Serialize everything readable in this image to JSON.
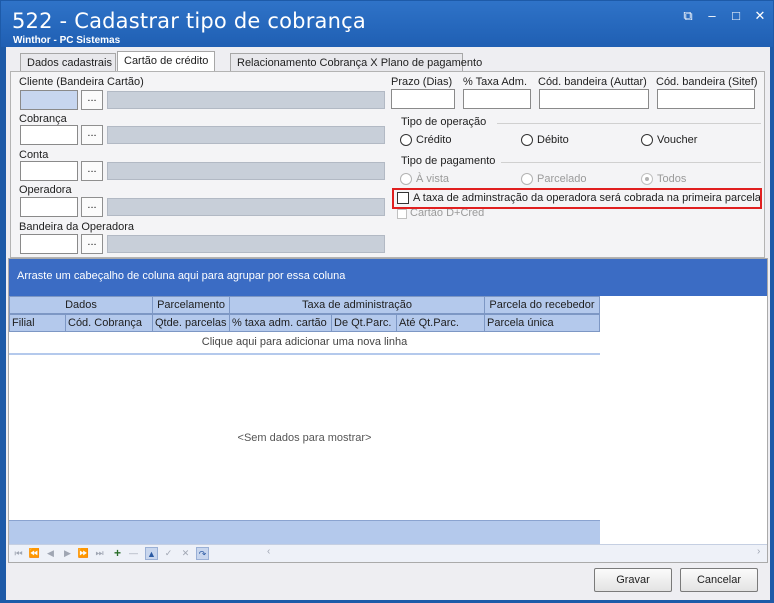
{
  "window": {
    "title": "522 - Cadastrar tipo de cobrança",
    "subtitle": "Winthor - PC Sistemas",
    "controls": [
      "⧉",
      "–",
      "□",
      "✕"
    ]
  },
  "tabs": [
    {
      "label": "Dados cadastrais"
    },
    {
      "label": "Cartão de crédito",
      "active": true
    },
    {
      "label": "Relacionamento Cobrança X Plano de pagamento"
    }
  ],
  "form": {
    "cliente_label": "Cliente (Bandeira Cartão)",
    "cobranca_label": "Cobrança",
    "conta_label": "Conta",
    "operadora_label": "Operadora",
    "bandeira_operadora_label": "Bandeira da Operadora",
    "lookup_button": "...",
    "prazo_label": "Prazo (Dias)",
    "taxa_label": "% Taxa Adm.",
    "cod_auttar_label": "Cód. bandeira (Auttar)",
    "cod_sitef_label": "Cód. bandeira (Sitef)",
    "tipo_operacao": {
      "title": "Tipo de operação",
      "options": [
        "Crédito",
        "Débito",
        "Voucher"
      ]
    },
    "tipo_pagamento": {
      "title": "Tipo de pagamento",
      "options": [
        "À vista",
        "Parcelado",
        "Todos"
      ],
      "selected": "Todos"
    },
    "taxa_primeira_parcela_label": "A taxa de adminstração da operadora será cobrada na primeira parcela",
    "cartao_dcred_label": "Cartão D+Cred"
  },
  "grid": {
    "group_panel_text": "Arraste um cabeçalho de coluna aqui para agrupar por essa coluna",
    "bands": [
      "Dados",
      "Parcelamento",
      "Taxa de administração",
      "Parcela do recebedor"
    ],
    "columns": [
      "Filial",
      "Cód. Cobrança",
      "Qtde. parcelas",
      "% taxa adm. cartão",
      "De Qt.Parc.",
      "Até Qt.Parc.",
      "Parcela única"
    ],
    "new_row_text": "Clique aqui para adicionar uma nova linha",
    "empty_text": "<Sem dados para mostrar>",
    "navigator": [
      "⏮",
      "⏪",
      "◀",
      "▶",
      "⏩",
      "⏭",
      "+",
      "—",
      "▲",
      "✓",
      "✕",
      "↷"
    ]
  },
  "buttons": {
    "save": "Gravar",
    "cancel": "Cancelar"
  }
}
